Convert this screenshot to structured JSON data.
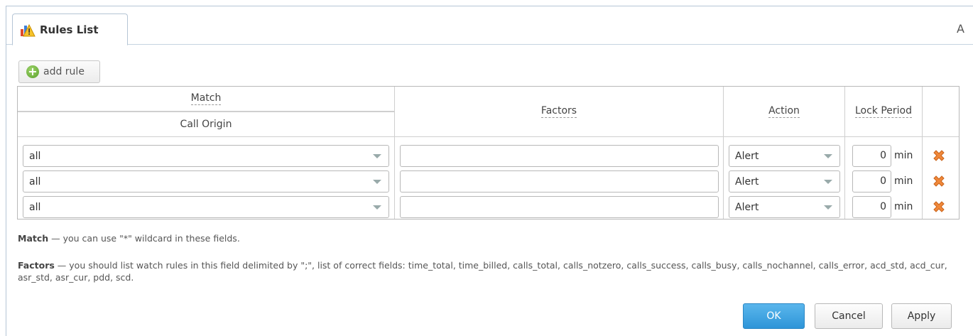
{
  "tab": {
    "title": "Rules List",
    "right_label": "A"
  },
  "toolbar": {
    "add_rule_label": "add rule"
  },
  "table": {
    "headers": {
      "match": "Match",
      "call_origin": "Call Origin",
      "factors": "Factors",
      "action": "Action",
      "lock_period": "Lock Period"
    },
    "rows": [
      {
        "origin": "all",
        "factors": "",
        "action": "Alert",
        "lock": "0",
        "unit": "min"
      },
      {
        "origin": "all",
        "factors": "",
        "action": "Alert",
        "lock": "0",
        "unit": "min"
      },
      {
        "origin": "all",
        "factors": "",
        "action": "Alert",
        "lock": "0",
        "unit": "min"
      }
    ]
  },
  "notes": {
    "match_term": "Match",
    "match_text": " — you can use \"*\" wildcard in these fields.",
    "factors_term": "Factors",
    "factors_text": " — you should list watch rules in this field delimited by \";\", list of correct fields: time_total, time_billed, calls_total, calls_notzero, calls_success, calls_busy, calls_nochannel, calls_error, acd_std, acd_cur, asr_std, asr_cur, pdd, scd."
  },
  "buttons": {
    "ok": "OK",
    "cancel": "Cancel",
    "apply": "Apply"
  },
  "icons": {
    "tab": "rules-chart-icon",
    "add": "plus-circle-icon",
    "delete": "delete-x-icon"
  },
  "colors": {
    "primary": "#2e95d8",
    "delete": "#f0883a",
    "add": "#5aa02c"
  }
}
